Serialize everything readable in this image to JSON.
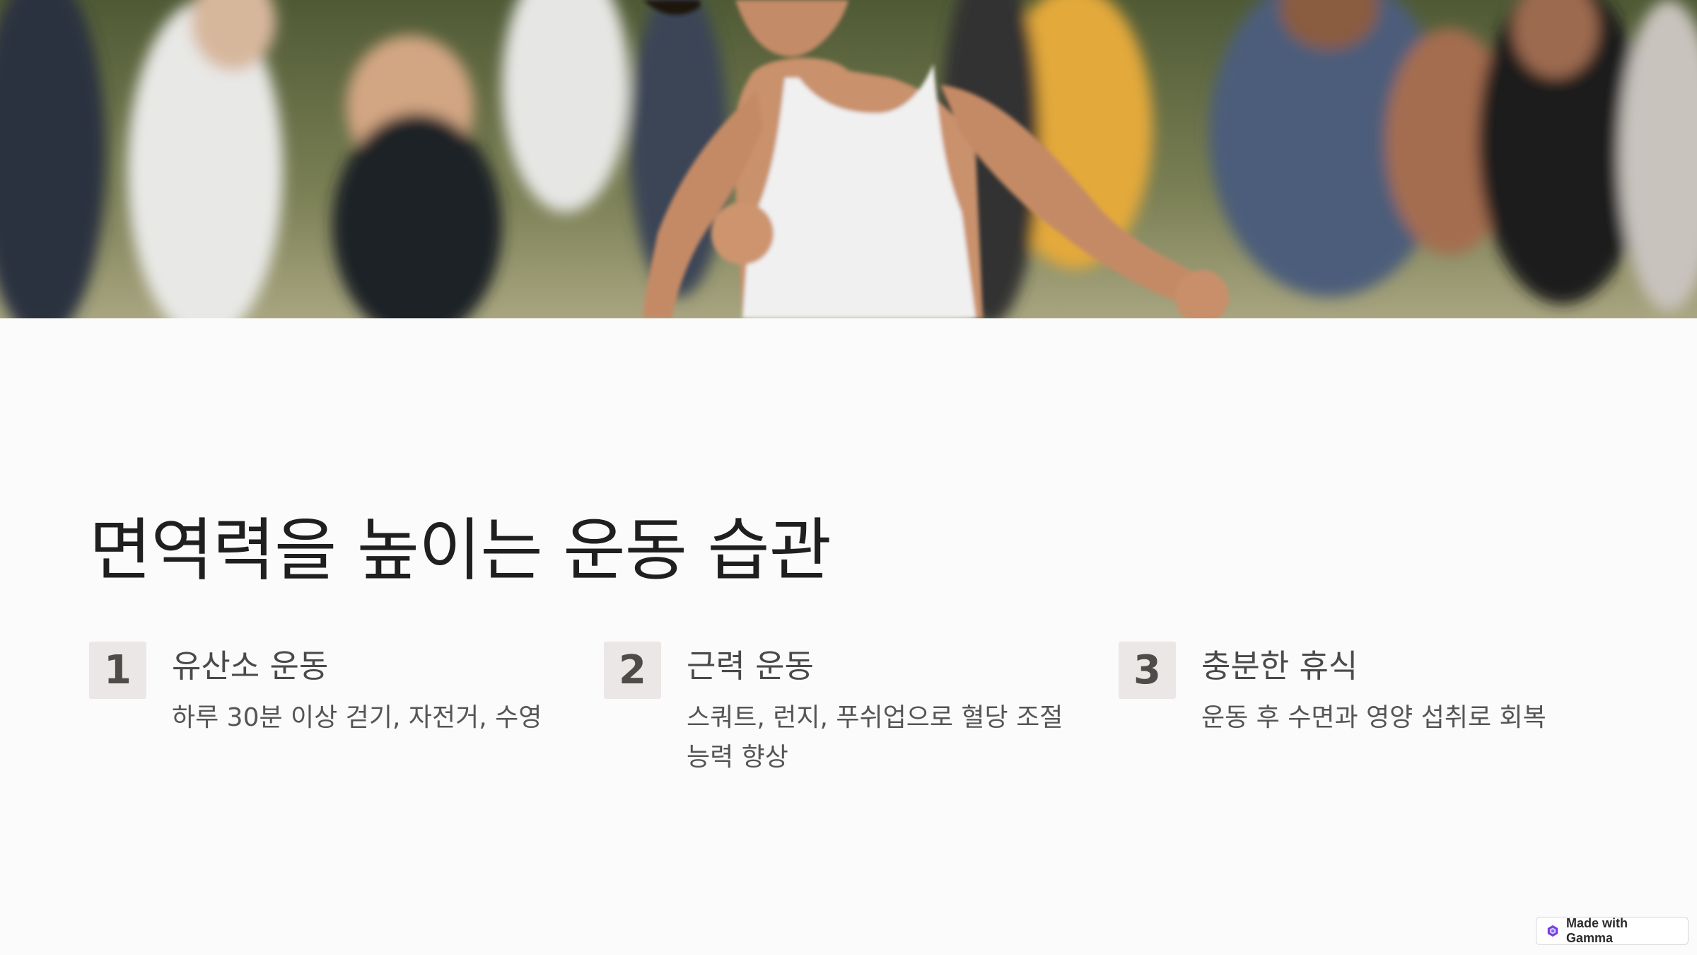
{
  "hero": {
    "image_alt": "group of people running outdoors"
  },
  "title": "면역력을 높이는 운동 습관",
  "items": [
    {
      "number": "1",
      "title": "유산소 운동",
      "description": "하루 30분 이상 걷기, 자전거, 수영"
    },
    {
      "number": "2",
      "title": "근력 운동",
      "description": "스쿼트, 런지, 푸쉬업으로 혈당 조절 능력 향상"
    },
    {
      "number": "3",
      "title": "충분한 휴식",
      "description": "운동 후 수면과 영양 섭취로 회복"
    }
  ],
  "badge": {
    "label": "Made with Gamma",
    "icon": "gamma-logo-icon",
    "accent": "#7b3fe4"
  },
  "colors": {
    "background": "#fbfbfb",
    "number_box": "#ebe7e6",
    "title_text": "#1f1f1f"
  }
}
